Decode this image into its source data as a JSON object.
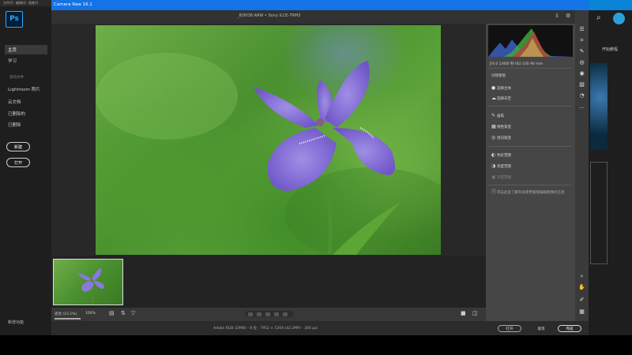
{
  "window": {
    "title": "Camera Raw 16.1"
  },
  "ps": {
    "logo": "Ps",
    "menu": [
      "文件(F)",
      "编辑(E)",
      "图像(I)"
    ],
    "nav": [
      {
        "label": "主页",
        "active": true
      },
      {
        "label": "学习",
        "active": false
      }
    ],
    "section_label": "您的文件",
    "files": [
      "Lightroom 照片",
      "云文档",
      "已删除的",
      "已删除"
    ],
    "buttons": {
      "new": "新建",
      "open": "打开"
    },
    "new_features": "新增功能",
    "right_title": "开始教程"
  },
  "toolbar": {
    "file_info": "_8/9036.ARW  •  Sony  ILCE-7RM3"
  },
  "histogram_info": "ƒ/4.0   1/800 秒   ISO 100   90 mm",
  "panel": {
    "head": "创建蒙版",
    "groups": [
      [
        {
          "icon": "person-icon",
          "label": "选择主体"
        },
        {
          "icon": "sky-icon",
          "label": "选择天空"
        }
      ],
      [
        {
          "icon": "brush-icon",
          "label": "画笔"
        },
        {
          "icon": "linear-gradient-icon",
          "label": "线性渐变"
        },
        {
          "icon": "radial-gradient-icon",
          "label": "径向渐变"
        }
      ],
      [
        {
          "icon": "color-range-icon",
          "label": "色彩范围"
        },
        {
          "icon": "luminance-range-icon",
          "label": "亮度范围"
        },
        {
          "icon": "depth-range-icon",
          "label": "深度范围",
          "dim": true
        }
      ]
    ],
    "note": "单击此处了解有关使用蒙版编辑图像的信息"
  },
  "bottom_tools": {
    "zoom_label": "适合 (23.1%)",
    "zoom_pct": "100%"
  },
  "status": {
    "info": "Adobe RGB (1998) - 8 位 - 7952 × 5304 (42.2MP) - 300 ppi"
  },
  "footer": {
    "open": "打开",
    "cancel": "取消",
    "done": "完成"
  },
  "colors": {
    "title_bar": "#1473e6",
    "ps_blue": "#31a8ff",
    "panel_bg": "#464646"
  }
}
